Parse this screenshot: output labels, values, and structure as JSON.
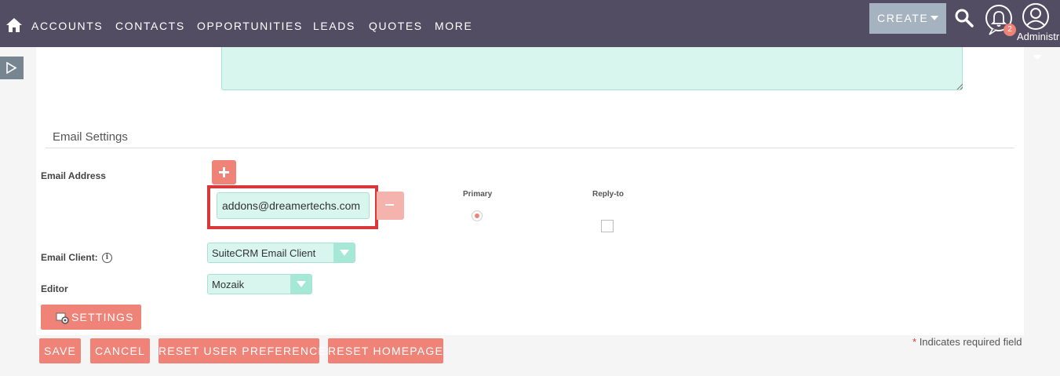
{
  "nav": {
    "links": [
      "ACCOUNTS",
      "CONTACTS",
      "OPPORTUNITIES",
      "LEADS",
      "QUOTES",
      "MORE"
    ],
    "create_label": "CREATE",
    "notification_count": "2",
    "user_label": "Administr"
  },
  "form": {
    "section_title": "Email Settings",
    "email_address_label": "Email Address",
    "email_value": "addons@dreamertechs.com",
    "primary_label": "Primary",
    "reply_to_label": "Reply-to",
    "primary_selected": true,
    "reply_to_checked": false,
    "email_client_label": "Email Client:",
    "email_client_value": "SuiteCRM Email Client",
    "editor_label": "Editor",
    "editor_value": "Mozaik",
    "settings_label": "SETTINGS"
  },
  "actions": {
    "save": "SAVE",
    "cancel": "CANCEL",
    "reset_user_prefs": "RESET USER PREFERENCES",
    "reset_homepage": "RESET HOMEPAGE"
  },
  "required_note": {
    "star": "*",
    "text": "Indicates required field"
  },
  "colors": {
    "nav_bg": "#534d64",
    "accent": "#f08377",
    "field_bg": "#d8f5ee",
    "highlight": "#d9383a"
  },
  "icons": [
    "home-icon",
    "search-icon",
    "bell-icon",
    "user-icon",
    "plus-icon",
    "minus-icon",
    "info-icon",
    "dropdown-arrow-icon",
    "gear-icon",
    "sidebar-toggle-icon"
  ]
}
